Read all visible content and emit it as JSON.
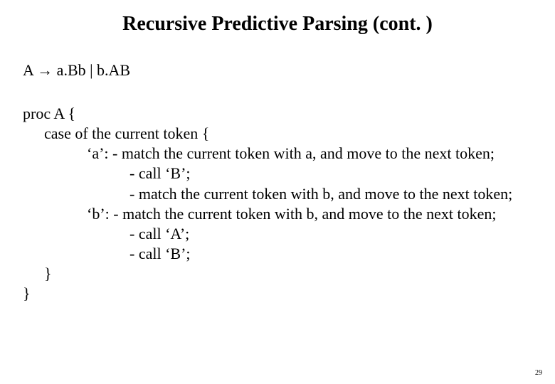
{
  "title": "Recursive Predictive Parsing (cont. )",
  "grammar": "A → a.Bb  |  b.AB",
  "proc": {
    "line1": "proc A {",
    "line2": "case of the current token {",
    "case_a_label": "‘a’:   - match the current token with a, and move to the next token;",
    "case_a_step2": "- call ‘B’;",
    "case_a_step3": "- match the current token with b, and move to the next token;",
    "case_b_label": "‘b’:  - match the current token with b, and move to the next token;",
    "case_b_step2": "- call ‘A’;",
    "case_b_step3": "- call ‘B’;",
    "close_inner": "}",
    "close_outer": "}"
  },
  "page_number": "29"
}
